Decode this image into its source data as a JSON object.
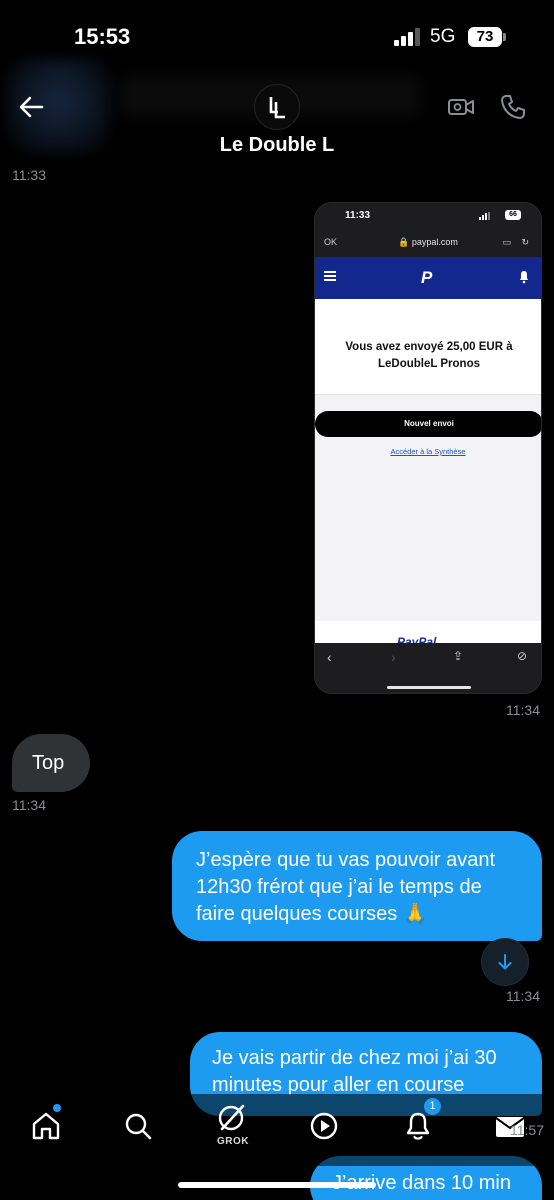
{
  "status_bar": {
    "time": "15:53",
    "network": "5G",
    "battery": "73"
  },
  "header": {
    "contact_name": "Le Double L"
  },
  "messages": {
    "ts_top": "11:33",
    "image_timestamp": "11:34",
    "received_1": {
      "text": "Top",
      "timestamp": "11:34"
    },
    "sent_1": {
      "text": "J’espère que tu vas pouvoir avant 12h30 frérot que j’ai le temps de faire quelques courses 🙏",
      "timestamp": "11:34"
    },
    "sent_2": {
      "text": "Je vais partir de chez moi j’ai 30 minutes pour aller en course",
      "timestamp": "11:57"
    },
    "sent_3": {
      "text": "J’arrive dans 10 min"
    }
  },
  "screenshot": {
    "time": "11:33",
    "battery": "66",
    "back_label": "OK",
    "url": "🔒 paypal.com",
    "confirmation": "Vous avez envoyé 25,00 EUR à LeDoubleL Pronos",
    "new_send_button": "Nouvel envoi",
    "summary_link": "Accéder à la Synthèse",
    "footer_logo": "PayPal"
  },
  "bottom_nav": {
    "grok_label": "GROK",
    "notifications_count": "1"
  },
  "colors": {
    "accent": "#1d9bf0",
    "bubble_in": "#2f3336",
    "paypal_navy": "#13288f"
  }
}
